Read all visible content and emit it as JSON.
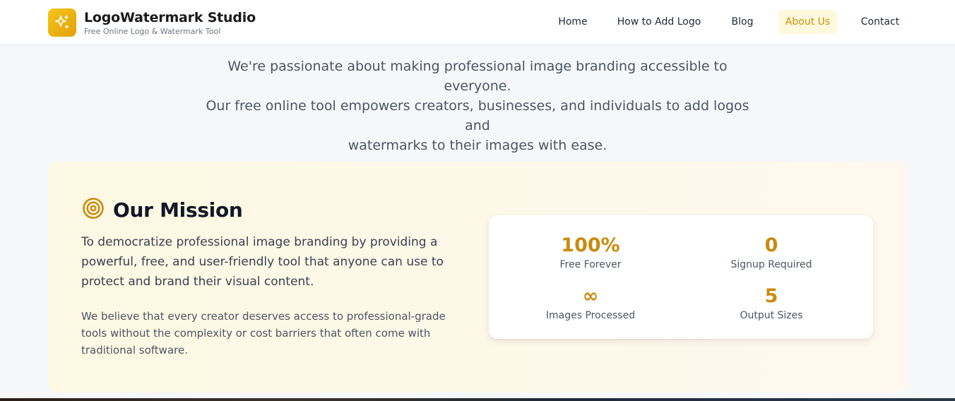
{
  "header": {
    "brand_title": "LogoWatermark Studio",
    "brand_subtitle": "Free Online Logo & Watermark Tool",
    "brand_icon": "sparkles-icon",
    "nav": [
      {
        "label": "Home",
        "active": false
      },
      {
        "label": "How to Add Logo",
        "active": false
      },
      {
        "label": "Blog",
        "active": false
      },
      {
        "label": "About Us",
        "active": true
      },
      {
        "label": "Contact",
        "active": false
      }
    ]
  },
  "intro": {
    "line1": "We're passionate about making professional image branding accessible to everyone.",
    "line2": "Our free online tool empowers creators, businesses, and individuals to add logos and",
    "line3": "watermarks to their images with ease."
  },
  "mission": {
    "icon": "target-icon",
    "title": "Our Mission",
    "lead": "To democratize professional image branding by providing a powerful, free, and user-friendly tool that anyone can use to protect and brand their visual content.",
    "body": "We believe that every creator deserves access to professional-grade tools without the complexity or cost barriers that often come with traditional software."
  },
  "stats": [
    {
      "value": "100%",
      "label": "Free Forever"
    },
    {
      "value": "0",
      "label": "Signup Required"
    },
    {
      "value": "∞",
      "label": "Images Processed"
    },
    {
      "value": "5",
      "label": "Output Sizes"
    }
  ],
  "colors": {
    "accent": "#ca8a0f",
    "brand_gradient_start": "#f5c518",
    "active_nav_bg": "#fef8dc",
    "mission_bg": "#fef9e3"
  }
}
